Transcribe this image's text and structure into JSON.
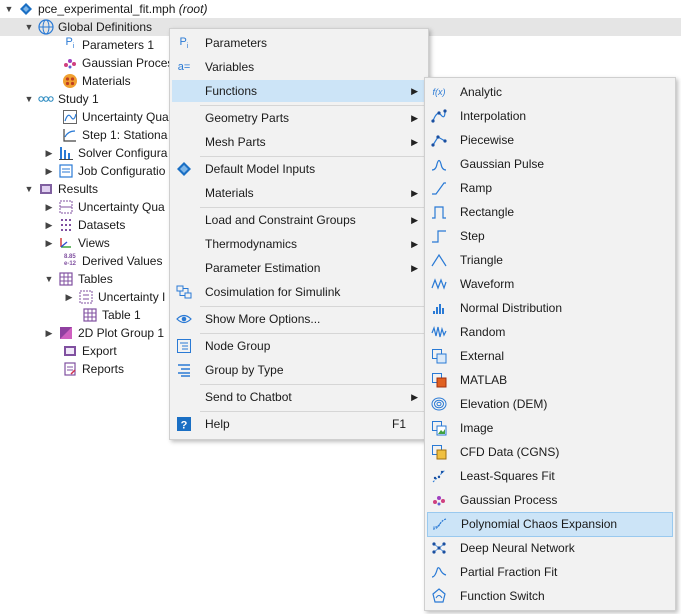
{
  "tree": {
    "root": {
      "name": "pce_experimental_fit.mph",
      "suffix": "(root)"
    },
    "global_definitions": "Global Definitions",
    "parameters1": "Parameters 1",
    "gaussian_process": "Gaussian Proces",
    "materials": "Materials",
    "study1": "Study 1",
    "uncertainty_qua1": "Uncertainty Qua",
    "step1": "Step 1: Stationa",
    "solver_config": "Solver Configura",
    "job_config": "Job Configuratio",
    "results": "Results",
    "uncertainty_qua2": "Uncertainty Qua",
    "datasets": "Datasets",
    "views": "Views",
    "derived_values": "Derived Values",
    "tables": "Tables",
    "uncertainty_t": "Uncertainty I",
    "table1": "Table 1",
    "plot_group": "2D Plot Group 1",
    "export": "Export",
    "reports": "Reports"
  },
  "context_menu": {
    "items": [
      {
        "label": "Parameters",
        "icon": "parameters-icon"
      },
      {
        "label": "Variables",
        "icon": "variables-icon"
      },
      {
        "label": "Functions",
        "icon": "",
        "submenu": true
      },
      {
        "label": "Geometry Parts",
        "submenu": true
      },
      {
        "label": "Mesh Parts",
        "submenu": true
      },
      {
        "label": "Default Model Inputs",
        "icon": "default-model-inputs-icon"
      },
      {
        "label": "Materials",
        "submenu": true
      },
      {
        "label": "Load and Constraint Groups",
        "submenu": true
      },
      {
        "label": "Thermodynamics",
        "submenu": true
      },
      {
        "label": "Parameter Estimation",
        "submenu": true
      },
      {
        "label": "Cosimulation for Simulink",
        "icon": "cosimulation-icon"
      },
      {
        "label": "Show More Options...",
        "icon": "eye-icon"
      },
      {
        "label": "Node Group",
        "icon": "node-group-icon"
      },
      {
        "label": "Group by Type",
        "icon": "group-by-type-icon"
      },
      {
        "label": "Send to Chatbot",
        "submenu": true
      },
      {
        "label": "Help",
        "icon": "help-icon",
        "shortcut": "F1"
      }
    ]
  },
  "functions_menu": {
    "items": [
      {
        "label": "Analytic",
        "icon": "analytic-icon"
      },
      {
        "label": "Interpolation",
        "icon": "interpolation-icon"
      },
      {
        "label": "Piecewise",
        "icon": "piecewise-icon"
      },
      {
        "label": "Gaussian Pulse",
        "icon": "gaussian-pulse-icon"
      },
      {
        "label": "Ramp",
        "icon": "ramp-icon"
      },
      {
        "label": "Rectangle",
        "icon": "rectangle-icon"
      },
      {
        "label": "Step",
        "icon": "step-icon"
      },
      {
        "label": "Triangle",
        "icon": "triangle-icon"
      },
      {
        "label": "Waveform",
        "icon": "waveform-icon"
      },
      {
        "label": "Normal Distribution",
        "icon": "normal-distribution-icon"
      },
      {
        "label": "Random",
        "icon": "random-icon"
      },
      {
        "label": "External",
        "icon": "external-icon"
      },
      {
        "label": "MATLAB",
        "icon": "matlab-icon"
      },
      {
        "label": "Elevation (DEM)",
        "icon": "elevation-icon"
      },
      {
        "label": "Image",
        "icon": "image-icon"
      },
      {
        "label": "CFD Data (CGNS)",
        "icon": "cfd-data-icon"
      },
      {
        "label": "Least-Squares Fit",
        "icon": "least-squares-fit-icon"
      },
      {
        "label": "Gaussian Process",
        "icon": "gaussian-process-icon"
      },
      {
        "label": "Polynomial Chaos Expansion",
        "icon": "polynomial-chaos-icon"
      },
      {
        "label": "Deep Neural Network",
        "icon": "deep-neural-network-icon"
      },
      {
        "label": "Partial Fraction Fit",
        "icon": "partial-fraction-fit-icon"
      },
      {
        "label": "Function Switch",
        "icon": "function-switch-icon"
      }
    ]
  },
  "colors": {
    "accent": "#1a6fc4",
    "selection": "#cce4f7",
    "tree_selection": "#e5e5e5"
  }
}
